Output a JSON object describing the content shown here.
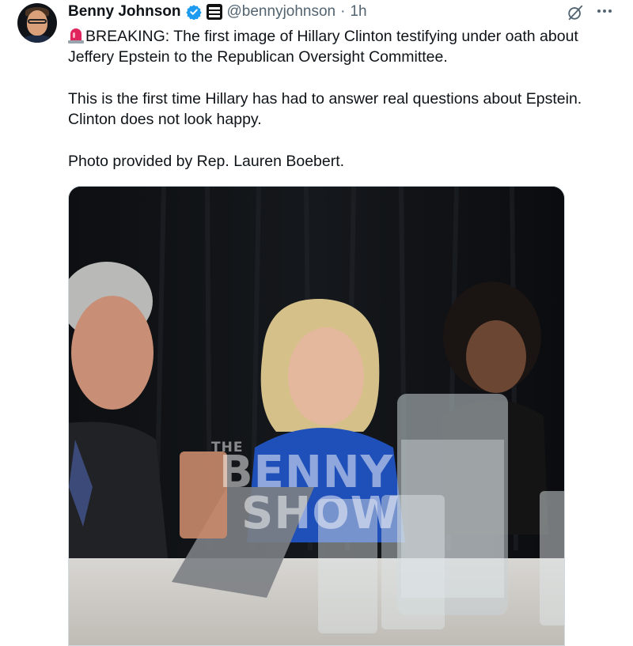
{
  "author": {
    "name": "Benny Johnson",
    "handle": "@bennyjohnson",
    "separator": "·",
    "time": "1h",
    "verified_color": "#1d9bf0",
    "avatar": "profile-photo"
  },
  "icons": {
    "verified": "verified-badge-icon",
    "affiliation": "affiliate-badge-icon",
    "grok": "grok-icon",
    "more": "more-icon",
    "siren": "rotating-light-emoji"
  },
  "tweet": {
    "paragraph1": "BREAKING: The first image of Hillary Clinton testifying under oath about Jeffery Epstein to the Republican Oversight Committee.",
    "paragraph2": "This is the first time Hillary has had to answer real questions about Epstein. Clinton does not look happy.",
    "paragraph3": "Photo provided by Rep. Lauren Boebert."
  },
  "media": {
    "type": "photo",
    "watermark": {
      "small": "THE",
      "line1": "BENNY",
      "line2": "SHOW"
    }
  },
  "colors": {
    "text": "#0f1419",
    "secondary": "#536471",
    "accent": "#1d9bf0",
    "border": "#cfd9de"
  }
}
